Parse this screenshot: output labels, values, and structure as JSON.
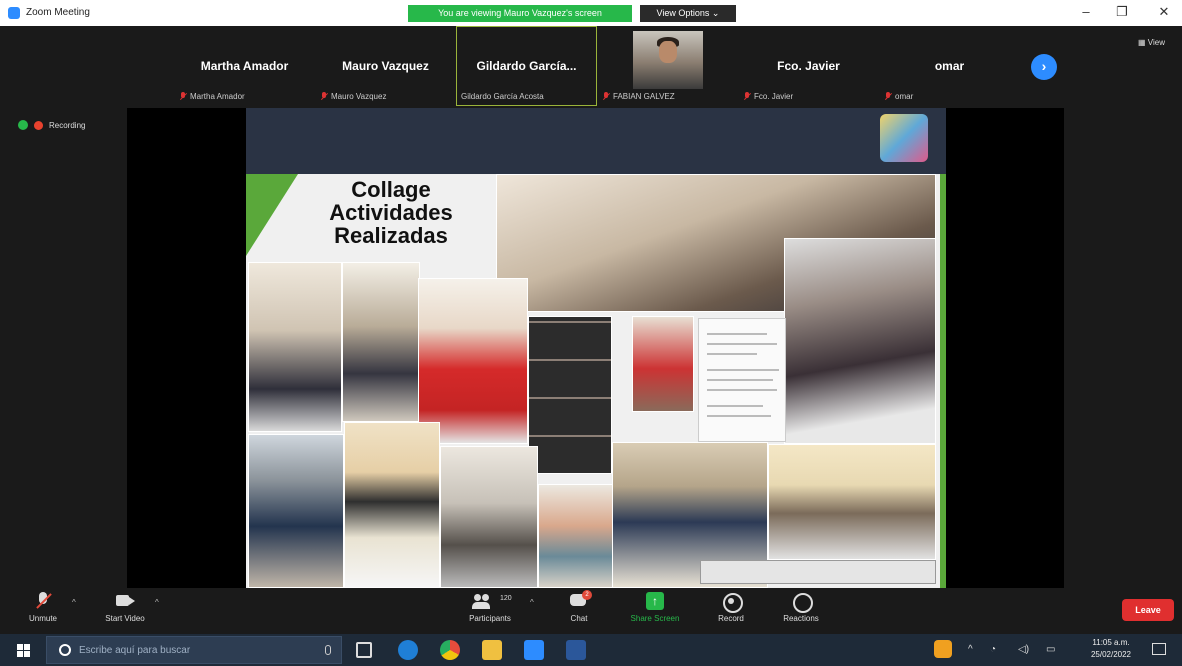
{
  "window": {
    "title": "Zoom Meeting",
    "share_banner": "You are viewing Mauro Vazquez's screen",
    "view_options": "View Options ⌄",
    "minimize": "–",
    "restore": "❐",
    "close": "✕"
  },
  "gallery": {
    "participants": [
      {
        "display": "Martha Amador",
        "label": "Martha Amador",
        "muted": true
      },
      {
        "display": "Mauro Vazquez",
        "label": "Mauro Vazquez",
        "muted": true
      },
      {
        "display": "Gildardo García...",
        "label": "Gildardo García Acosta",
        "muted": false
      },
      {
        "display": "",
        "label": "FABIAN GALVEZ",
        "muted": true
      },
      {
        "display": "Fco. Javier",
        "label": "Fco. Javier",
        "muted": true
      },
      {
        "display": "omar",
        "label": "omar",
        "muted": true
      }
    ],
    "view_label": "View"
  },
  "status": {
    "recording_label": "Recording"
  },
  "slide": {
    "title_line1": "Collage",
    "title_line2": "Actividades",
    "title_line3": "Realizadas"
  },
  "toolbar": {
    "unmute_label": "Unmute",
    "start_video_label": "Start Video",
    "participants_count": "120",
    "participants_label": "Participants",
    "chat_label": "Chat",
    "chat_badge": "2",
    "share_label": "Share Screen",
    "record_label": "Record",
    "reactions_label": "Reactions",
    "leave_label": "Leave"
  },
  "taskbar": {
    "search_placeholder": "Escribe aquí para buscar",
    "time": "11:05 a.m.",
    "date": "25/02/2022"
  },
  "colors": {
    "zoom_blue": "#2d8cff",
    "share_green": "#27b84a",
    "leave_red": "#e02f2f",
    "slide_green": "#5aa83a",
    "slide_header": "#2a3344"
  }
}
